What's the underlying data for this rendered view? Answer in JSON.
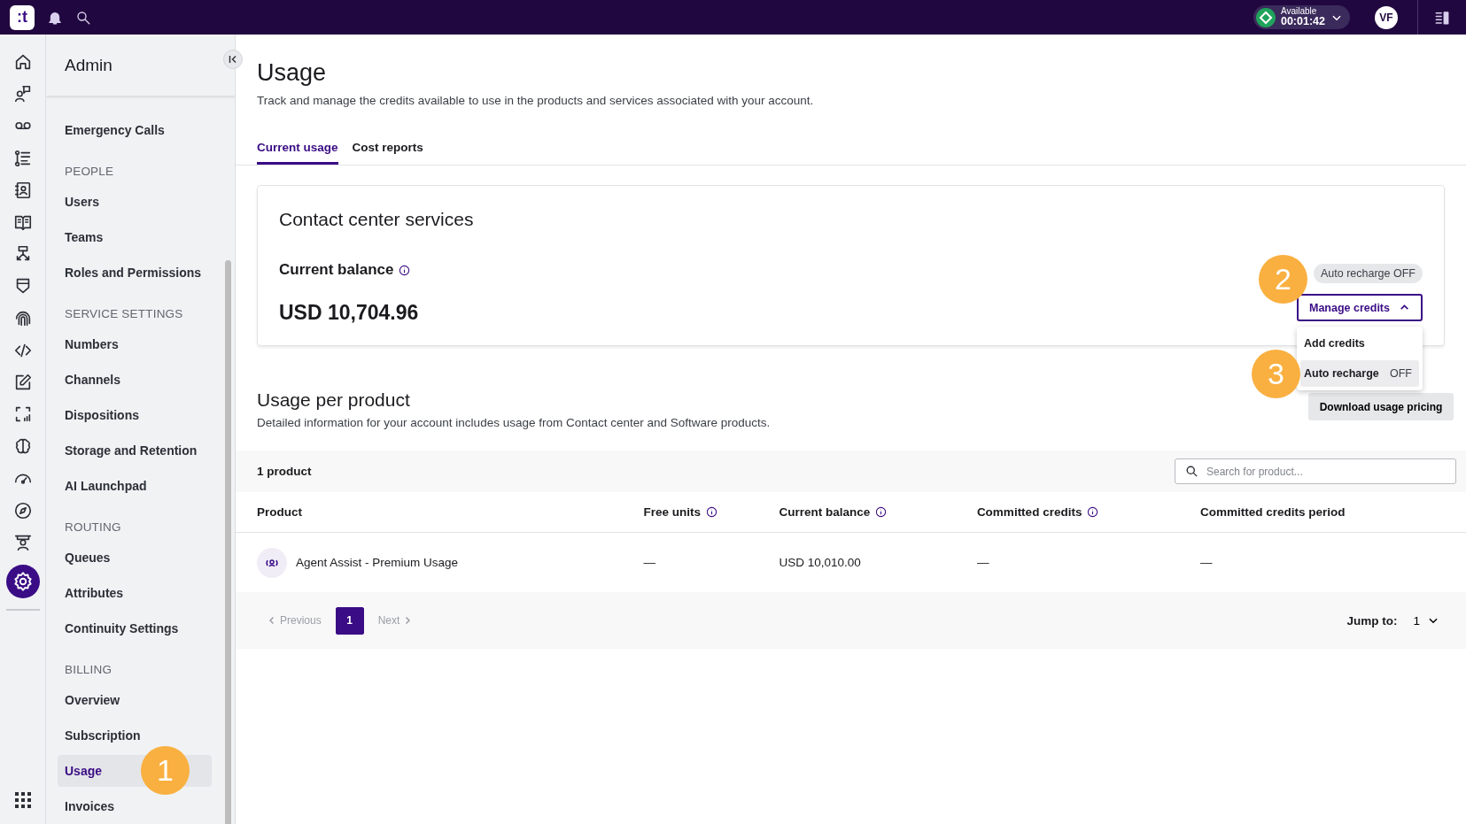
{
  "topbar": {
    "logo": ":t",
    "status": {
      "label": "Available",
      "timer": "00:01:42"
    },
    "avatar": "VF"
  },
  "rail": {
    "items": [
      {
        "selected": false
      },
      {
        "selected": false
      },
      {
        "selected": false
      },
      {
        "selected": false
      },
      {
        "selected": false
      },
      {
        "selected": false
      },
      {
        "selected": false
      },
      {
        "selected": false
      },
      {
        "selected": false
      },
      {
        "selected": false
      },
      {
        "selected": false
      },
      {
        "selected": false
      },
      {
        "selected": false
      },
      {
        "selected": false
      },
      {
        "selected": false
      },
      {
        "selected": false
      },
      {
        "selected": true
      }
    ]
  },
  "sidebar": {
    "title": "Admin",
    "sections": [
      {
        "items": [
          {
            "label": "Emergency Calls",
            "selected": false
          }
        ]
      },
      {
        "heading": "PEOPLE",
        "items": [
          {
            "label": "Users",
            "selected": false
          },
          {
            "label": "Teams",
            "selected": false
          },
          {
            "label": "Roles and Permissions",
            "selected": false
          }
        ]
      },
      {
        "heading": "SERVICE SETTINGS",
        "items": [
          {
            "label": "Numbers",
            "selected": false
          },
          {
            "label": "Channels",
            "selected": false
          },
          {
            "label": "Dispositions",
            "selected": false
          },
          {
            "label": "Storage and Retention",
            "selected": false
          },
          {
            "label": "AI Launchpad",
            "selected": false
          }
        ]
      },
      {
        "heading": "ROUTING",
        "items": [
          {
            "label": "Queues",
            "selected": false
          },
          {
            "label": "Attributes",
            "selected": false
          },
          {
            "label": "Continuity Settings",
            "selected": false
          }
        ]
      },
      {
        "heading": "BILLING",
        "items": [
          {
            "label": "Overview",
            "selected": false
          },
          {
            "label": "Subscription",
            "selected": false
          },
          {
            "label": "Usage",
            "selected": true,
            "callout": "1"
          },
          {
            "label": "Invoices",
            "selected": false
          }
        ]
      }
    ]
  },
  "page": {
    "title": "Usage",
    "subtitle": "Track and manage the credits available to use in the products and services associated with your account.",
    "tabs": [
      {
        "label": "Current usage",
        "selected": true
      },
      {
        "label": "Cost reports",
        "selected": false
      }
    ]
  },
  "card": {
    "title": "Contact center services",
    "balance_label": "Current balance",
    "balance": "USD 10,704.96",
    "auto_recharge_badge": "Auto recharge OFF",
    "manage_button": {
      "label": "Manage credits",
      "expanded": true,
      "callout": "2"
    },
    "menu": [
      {
        "label": "Add credits",
        "selected": false
      },
      {
        "label": "Auto recharge",
        "value": "OFF",
        "selected": true,
        "callout": "3"
      }
    ]
  },
  "usage": {
    "title": "Usage per product",
    "description": "Detailed information for your account includes usage from Contact center and Software products.",
    "download_button": "Download usage pricing",
    "count": "1 product",
    "search": {
      "placeholder": "Search for product..."
    },
    "columns": [
      {
        "label": "Product",
        "info": false
      },
      {
        "label": "Free units",
        "info": true
      },
      {
        "label": "Current balance",
        "info": true
      },
      {
        "label": "Committed credits",
        "info": true
      },
      {
        "label": "Committed credits period",
        "info": false
      }
    ],
    "rows": [
      {
        "cells": [
          "Agent Assist - Premium Usage",
          "—",
          "USD 10,010.00",
          "—",
          "—"
        ]
      }
    ],
    "pagination": {
      "previous": "Previous",
      "next": "Next",
      "pages": [
        {
          "label": "1",
          "selected": true
        }
      ],
      "jump_label": "Jump to:",
      "jump_value": "1"
    }
  }
}
